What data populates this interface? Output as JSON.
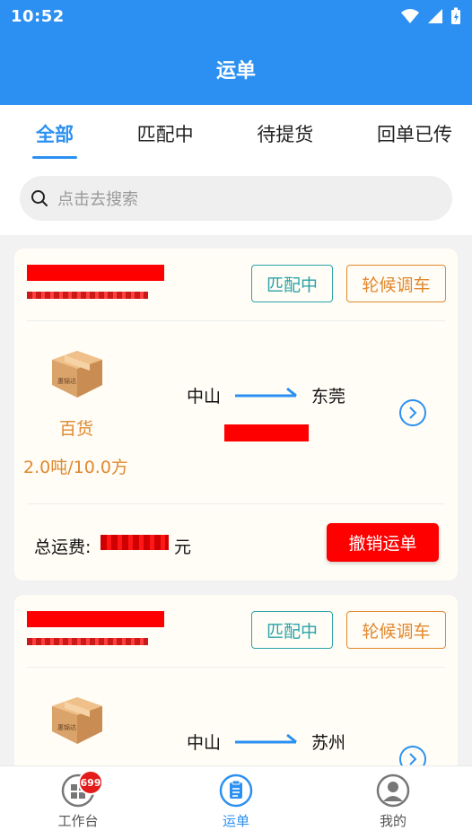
{
  "status_bar": {
    "time": "10:52"
  },
  "app_bar": {
    "title": "运单"
  },
  "tabs": [
    {
      "label": "全部",
      "active": true
    },
    {
      "label": "匹配中",
      "active": false
    },
    {
      "label": "待提货",
      "active": false
    },
    {
      "label": "回单已传",
      "active": false
    }
  ],
  "search": {
    "placeholder": "点击去搜索"
  },
  "orders": [
    {
      "status": "匹配中",
      "action": "轮候调车",
      "category": "百货",
      "capacity": "2.0吨/10.0方",
      "from": "中山",
      "to": "东莞",
      "fee_label": "总运费:",
      "fee_unit": "元",
      "cancel_label": "撤销运单",
      "box_label": "惠锦达"
    },
    {
      "status": "匹配中",
      "action": "轮候调车",
      "from": "中山",
      "to": "苏州",
      "box_label": "惠锦达"
    }
  ],
  "bottom_nav": [
    {
      "label": "工作台",
      "badge": "699",
      "icon": "dashboard-icon"
    },
    {
      "label": "运单",
      "icon": "clipboard-icon",
      "active": true
    },
    {
      "label": "我的",
      "icon": "user-icon"
    }
  ],
  "colors": {
    "primary": "#2b90f2",
    "teal": "#2aa3a8",
    "orange": "#e1882e",
    "red": "#ff0000"
  }
}
